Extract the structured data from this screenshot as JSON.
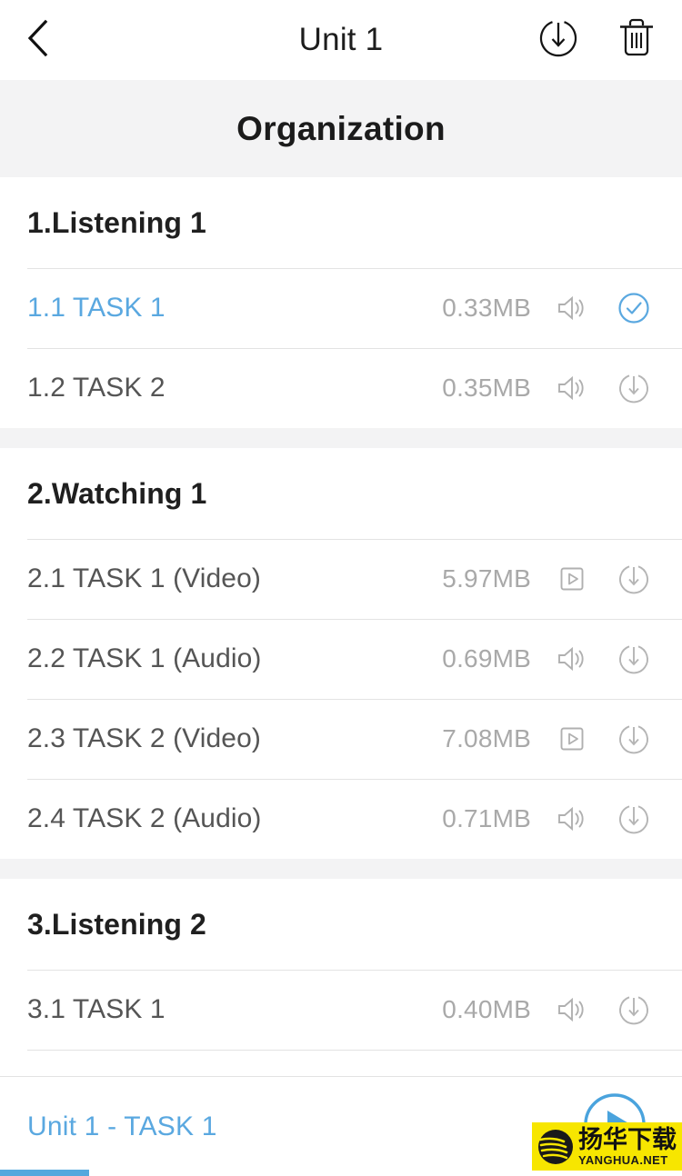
{
  "navbar": {
    "back_icon": "chevron-left-icon",
    "title": "Unit 1",
    "download_all_icon": "download-circle-icon",
    "delete_icon": "trash-icon"
  },
  "band": {
    "title": "Organization"
  },
  "colors": {
    "accent_blue": "#5aa8e0",
    "progress_blue": "#54a8dd",
    "band_gray": "#f3f3f4",
    "divider_gray": "#e3e3e3",
    "row_text_gray": "#555555",
    "size_text_gray": "#a9a9a9",
    "icon_gray": "#b0b0b0",
    "watermark_yellow": "#f7e600"
  },
  "sections": [
    {
      "header": "1.Listening 1",
      "rows": [
        {
          "title": "1.1 TASK 1",
          "size": "0.33MB",
          "media_icon": "speaker-icon",
          "status_icon": "check-circle-icon",
          "active": true
        },
        {
          "title": "1.2 TASK 2",
          "size": "0.35MB",
          "media_icon": "speaker-icon",
          "status_icon": "download-circle-icon",
          "active": false
        }
      ]
    },
    {
      "header": "2.Watching 1",
      "rows": [
        {
          "title": "2.1 TASK 1 (Video)",
          "size": "5.97MB",
          "media_icon": "video-play-icon",
          "status_icon": "download-circle-icon",
          "active": false
        },
        {
          "title": "2.2 TASK 1 (Audio)",
          "size": "0.69MB",
          "media_icon": "speaker-icon",
          "status_icon": "download-circle-icon",
          "active": false
        },
        {
          "title": "2.3 TASK 2 (Video)",
          "size": "7.08MB",
          "media_icon": "video-play-icon",
          "status_icon": "download-circle-icon",
          "active": false
        },
        {
          "title": "2.4 TASK 2 (Audio)",
          "size": "0.71MB",
          "media_icon": "speaker-icon",
          "status_icon": "download-circle-icon",
          "active": false
        }
      ]
    },
    {
      "header": "3.Listening 2",
      "rows": [
        {
          "title": "3.1 TASK 1",
          "size": "0.40MB",
          "media_icon": "speaker-icon",
          "status_icon": "download-circle-icon",
          "active": false
        }
      ]
    }
  ],
  "player": {
    "title": "Unit 1 - TASK 1",
    "play_icon": "play-circle-icon",
    "progress_percent": 13
  },
  "watermark": {
    "cn_text": "扬华下载",
    "en_text": "YANGHUA.NET",
    "logo_icon": "yanghua-logo-icon"
  }
}
